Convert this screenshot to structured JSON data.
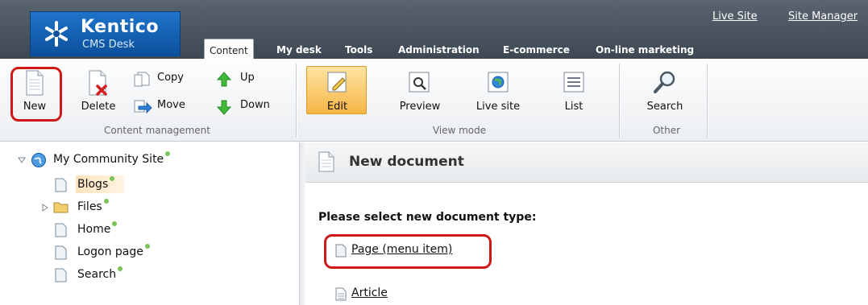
{
  "logo": {
    "brand": "Kentico",
    "subtitle": "CMS Desk"
  },
  "top_links": [
    "Live Site",
    "Site Manager"
  ],
  "tabs": [
    {
      "label": "Content",
      "active": true
    },
    {
      "label": "My desk"
    },
    {
      "label": "Tools"
    },
    {
      "label": "Administration"
    },
    {
      "label": "E-commerce"
    },
    {
      "label": "On-line marketing"
    }
  ],
  "ribbon": {
    "content_management": {
      "label": "Content management",
      "new": "New",
      "delete": "Delete",
      "copy": "Copy",
      "move": "Move",
      "up": "Up",
      "down": "Down"
    },
    "view_mode": {
      "label": "View mode",
      "edit": "Edit",
      "preview": "Preview",
      "live_site": "Live site",
      "list": "List"
    },
    "other": {
      "label": "Other",
      "search": "Search"
    }
  },
  "tree": {
    "root": "My Community Site",
    "items": [
      "Blogs",
      "Files",
      "Home",
      "Logon page",
      "Search"
    ],
    "selected": "Blogs"
  },
  "content": {
    "title": "New document",
    "prompt": "Please select new document type:",
    "doc_types": [
      "Page (menu item)",
      "Article"
    ]
  },
  "colors": {
    "header": "#4a545f",
    "logo": "#1565b8",
    "edit_active": "#f7b646",
    "highlight_ring": "#d01818",
    "status_dot": "#7cc35a"
  }
}
